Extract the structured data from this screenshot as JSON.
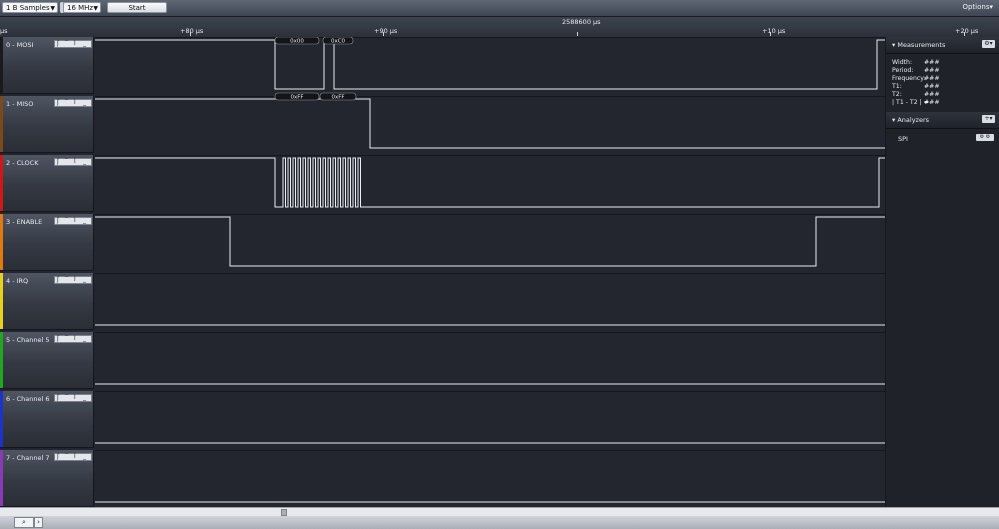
{
  "toolbar": {
    "samples_value": "1 B Samples",
    "frequency_value": "16 MHz",
    "start_label": "Start",
    "options_label": "Options▾"
  },
  "ruler": {
    "left_unit": "µs",
    "center_label": "2588600 µs",
    "ticks": [
      "+80 µs",
      "+90 µs",
      "+10 µs",
      "+20 µs"
    ]
  },
  "channels": [
    {
      "label": "0 - MOSI",
      "color": "#1a1a1a"
    },
    {
      "label": "1 - MISO",
      "color": "#7a4a1a"
    },
    {
      "label": "2 - CLOCK",
      "color": "#d01818"
    },
    {
      "label": "3 - ENABLE",
      "color": "#e07a10"
    },
    {
      "label": "4 - IRQ",
      "color": "#e6d21a"
    },
    {
      "label": "5 - Channel 5",
      "color": "#1fa81f"
    },
    {
      "label": "6 - Channel 6",
      "color": "#1d33c8"
    },
    {
      "label": "7 - Channel 7",
      "color": "#8a3ab5"
    }
  ],
  "decoded": {
    "mosi": [
      "0x00",
      "0xC0"
    ],
    "miso": [
      "0xFF",
      "0xFF"
    ]
  },
  "panel": {
    "measurements_title": "Measurements",
    "measurements": [
      {
        "key": "Width:",
        "value": "###"
      },
      {
        "key": "Period:",
        "value": "###"
      },
      {
        "key": "Frequency:",
        "value": "###"
      },
      {
        "key": "T1:",
        "value": "###"
      },
      {
        "key": "T2:",
        "value": "###"
      },
      {
        "key": "| T1 - T2 | =",
        "value": "###"
      }
    ],
    "analyzers_title": "Analyzers",
    "analyzer_name": "SPI"
  },
  "icons": {
    "dropdown": "chevron-down-icon",
    "trigger_rising": "rising-edge-icon",
    "trigger_high": "high-level-icon",
    "trigger_falling": "falling-edge-icon",
    "trigger_low": "low-level-icon",
    "settings": "gear-icon",
    "search": "search-icon"
  }
}
